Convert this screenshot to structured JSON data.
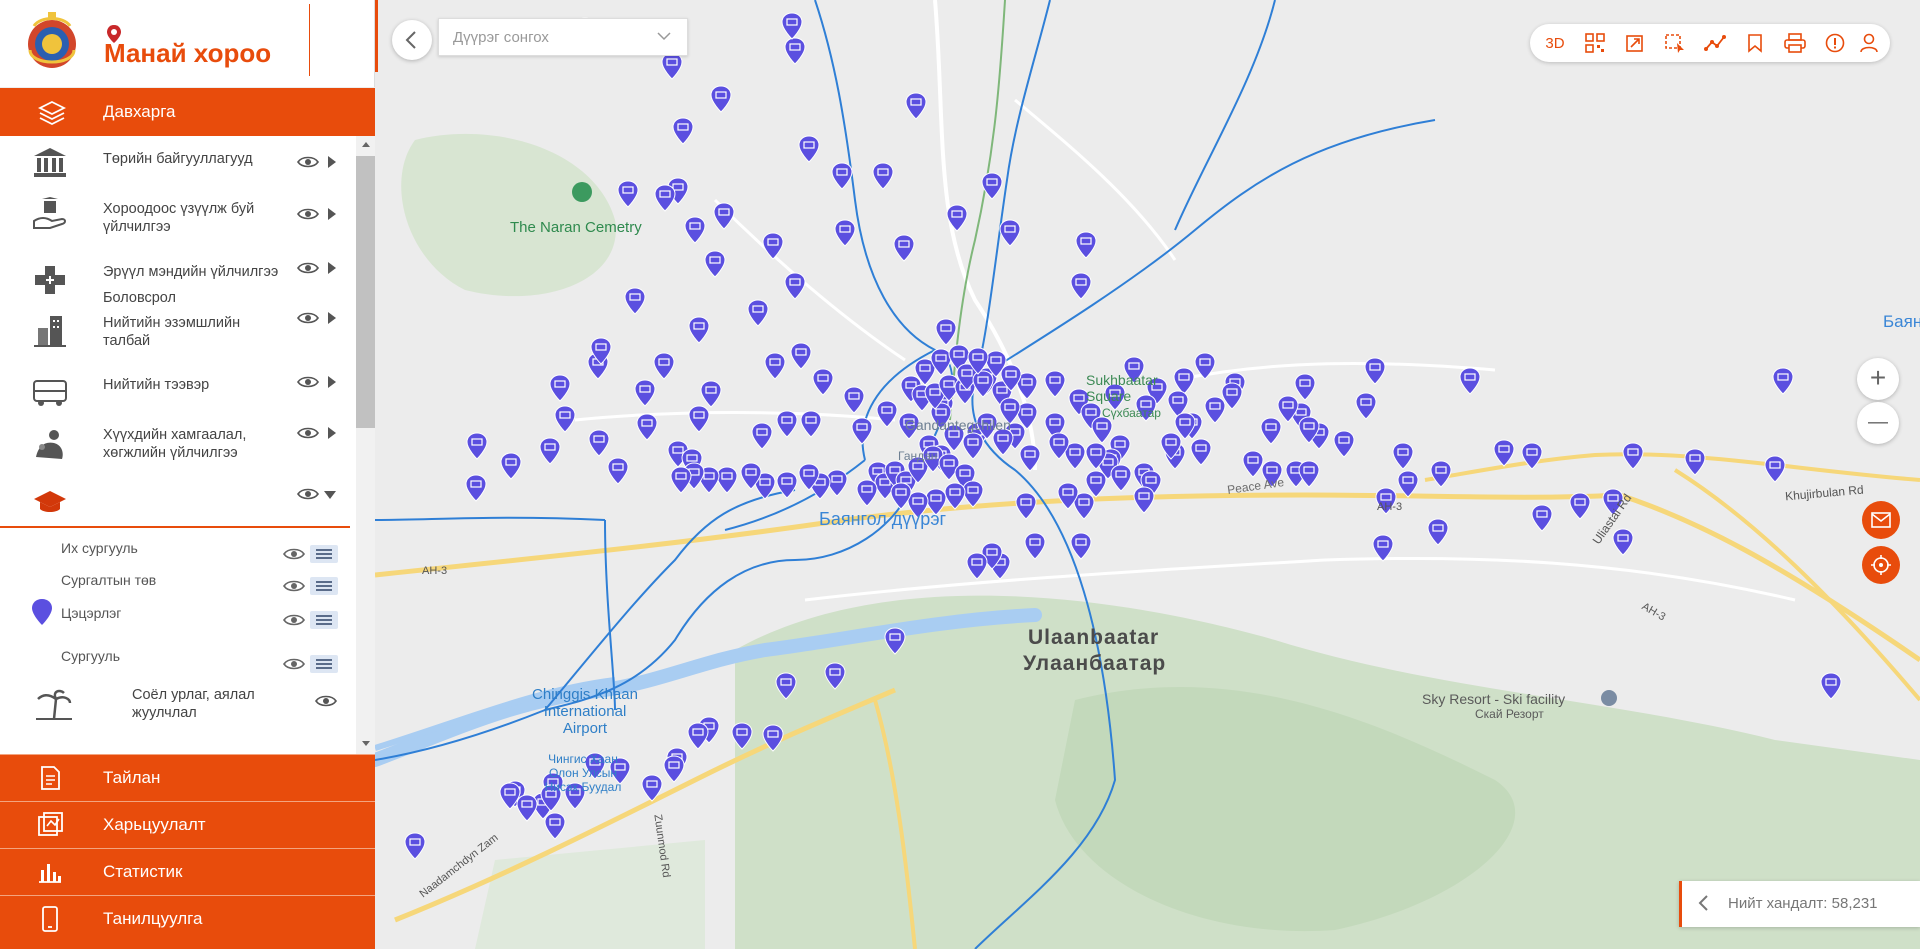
{
  "brand": {
    "title": "Манай хороо"
  },
  "sidebar": {
    "layer_header": "Давхарга",
    "layers": [
      {
        "label": "Төрийн байгууллагууд",
        "icon": "government-building-icon"
      },
      {
        "label": "Хороодоос үзүүлж буй үйлчилгээ",
        "icon": "hand-service-icon"
      },
      {
        "label": "Эрүүл мэндийн үйлчилгээ",
        "icon": "health-cross-icon"
      },
      {
        "label": "Нийтийн эзэмшлийн талбай",
        "icon": "public-area-icon"
      },
      {
        "label": "Нийтийн тээвэр",
        "icon": "bus-icon"
      },
      {
        "label": "Хүүхдийн хамгаалал, хөгжлийн үйлчилгээ",
        "icon": "child-care-icon"
      },
      {
        "label": "Боловсрол",
        "icon": "graduation-cap-icon"
      }
    ],
    "education_sublayers": [
      "Их сургууль",
      "Сургалтын төв",
      "Цэцэрлэг",
      "Сургууль"
    ],
    "culture_layer": "Соёл урлаг, аялал жуулчлал",
    "bottom_nav": [
      {
        "label": "Тайлан",
        "icon": "report-icon"
      },
      {
        "label": "Харьцуулалт",
        "icon": "comparison-icon"
      },
      {
        "label": "Статистик",
        "icon": "bar-chart-icon"
      },
      {
        "label": "Танилцуулга",
        "icon": "phone-icon"
      }
    ]
  },
  "map": {
    "district_select_placeholder": "Дүүрэг сонгох",
    "toolbar": [
      "3D",
      "qr-icon",
      "share-icon",
      "select-area-icon",
      "measure-line-icon",
      "bookmark-icon",
      "print-icon",
      "info-icon",
      "user-icon"
    ],
    "zoom_in": "+",
    "zoom_out": "—",
    "labels": {
      "cemetery": "The Naran Cemetry",
      "district": "Баянгол дүүрэг",
      "city_en": "Ulaanbaatar",
      "city_mn": "Улаанбаатар",
      "airport_en": "Chinggis Khaan International Airport",
      "airport_mn": "Чингис Хаан Олон Улсын Нисэх Буудал",
      "ski_en": "Sky Resort - Ski facility",
      "ski_mn": "Скай Резорт",
      "gandan": "Gandantegchilen",
      "gandan_mn": "Гандан",
      "square_en": "Sukhbaatar Square",
      "square_mn": "Сүхбаатар",
      "peace_ave": "Peace Ave",
      "ah3": "AH-3",
      "uliastai": "Uliastai Rd",
      "khujirbulan": "Khujirbulan Rd",
      "naadamchdyn": "Naadamchdyn Zam",
      "zuunmod": "Zuunmod Rd",
      "edge": "Баян"
    },
    "total_visits": "Нийт хандалт: 58,231"
  }
}
